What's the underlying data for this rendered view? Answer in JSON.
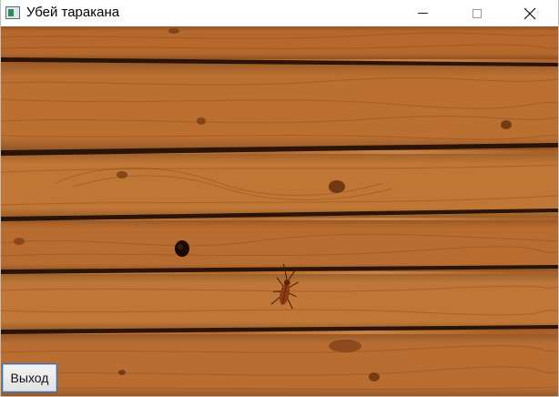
{
  "window": {
    "title": "Убей таракана",
    "icon": "app-window-icon",
    "controls": [
      "minimize-icon",
      "maximize-icon",
      "close-icon"
    ]
  },
  "game": {
    "background": "wooden-plank-wall",
    "target": "cockroach",
    "exit_label": "Выход"
  },
  "colors": {
    "wood_base": "#b8692c",
    "wood_dark": "#8f4a17",
    "wood_light": "#cf8a4a",
    "plank_gap": "#2a1406",
    "button_border": "#2f6fbf"
  }
}
